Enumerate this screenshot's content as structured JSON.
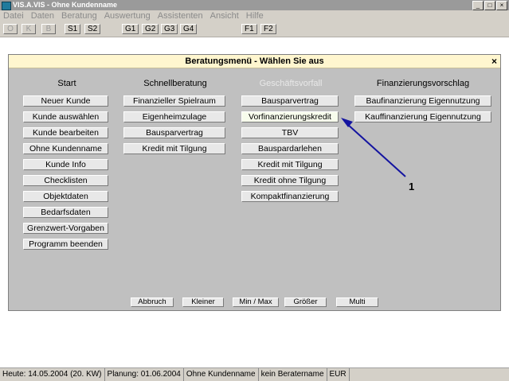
{
  "window": {
    "title": "VIS.A.VIS - Ohne Kundenname",
    "min": "_",
    "max": "□",
    "close": "×"
  },
  "menubar": [
    "Datei",
    "Daten",
    "Beratung",
    "Auswertung",
    "Assistenten",
    "Ansicht",
    "Hilfe"
  ],
  "toolbar": [
    "O",
    "K",
    "B",
    "S1",
    "S2",
    "G1",
    "G2",
    "G3",
    "G4",
    "F1",
    "F2"
  ],
  "dialog": {
    "title": "Beratungsmenü - Wählen Sie aus",
    "close": "×",
    "columns": [
      {
        "heading": "Start",
        "buttons": [
          "Neuer Kunde",
          "Kunde auswählen",
          "Kunde bearbeiten",
          "Ohne Kundenname",
          "Kunde Info",
          "Checklisten",
          "Objektdaten",
          "Bedarfsdaten",
          "Grenzwert-Vorgaben",
          "Programm beenden"
        ]
      },
      {
        "heading": "Schnellberatung",
        "buttons": [
          "Finanzieller Spielraum",
          "Eigenheimzulage",
          "Bausparvertrag",
          "Kredit mit Tilgung"
        ]
      },
      {
        "heading": "Geschäftsvorfall",
        "buttons": [
          "Bausparvertrag",
          "Vorfinanzierungskredit",
          "TBV",
          "Bauspardarlehen",
          "Kredit mit Tilgung",
          "Kredit ohne Tilgung",
          "Kompaktfinanzierung"
        ]
      },
      {
        "heading": "Finanzierungsvorschlag",
        "buttons": [
          "Baufinanzierung Eigennutzung",
          "Kauffinanzierung Eigennutzung"
        ]
      }
    ],
    "bottom_buttons": [
      "Abbruch",
      "Kleiner",
      "Min / Max",
      "Größer",
      "Multi"
    ]
  },
  "annotation": {
    "label": "1",
    "color": "#1414a0"
  },
  "statusbar": [
    "Heute: 14.05.2004 (20. KW)",
    "Planung: 01.06.2004",
    "Ohne Kundenname",
    "kein Beratername",
    "EUR"
  ]
}
